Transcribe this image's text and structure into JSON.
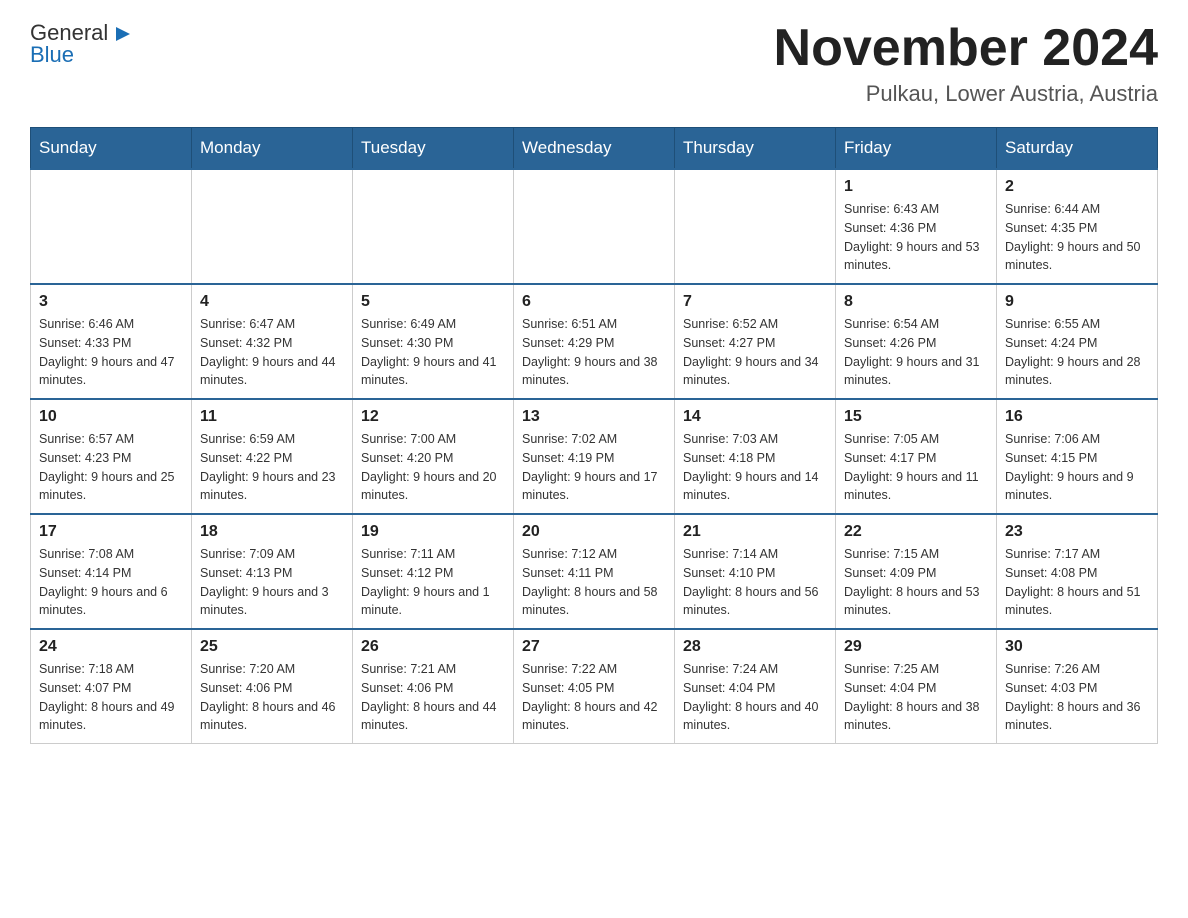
{
  "logo": {
    "text_general": "General",
    "text_blue": "Blue"
  },
  "header": {
    "title": "November 2024",
    "subtitle": "Pulkau, Lower Austria, Austria"
  },
  "days_of_week": [
    "Sunday",
    "Monday",
    "Tuesday",
    "Wednesday",
    "Thursday",
    "Friday",
    "Saturday"
  ],
  "weeks": [
    [
      {
        "day": "",
        "info": ""
      },
      {
        "day": "",
        "info": ""
      },
      {
        "day": "",
        "info": ""
      },
      {
        "day": "",
        "info": ""
      },
      {
        "day": "",
        "info": ""
      },
      {
        "day": "1",
        "info": "Sunrise: 6:43 AM\nSunset: 4:36 PM\nDaylight: 9 hours and 53 minutes."
      },
      {
        "day": "2",
        "info": "Sunrise: 6:44 AM\nSunset: 4:35 PM\nDaylight: 9 hours and 50 minutes."
      }
    ],
    [
      {
        "day": "3",
        "info": "Sunrise: 6:46 AM\nSunset: 4:33 PM\nDaylight: 9 hours and 47 minutes."
      },
      {
        "day": "4",
        "info": "Sunrise: 6:47 AM\nSunset: 4:32 PM\nDaylight: 9 hours and 44 minutes."
      },
      {
        "day": "5",
        "info": "Sunrise: 6:49 AM\nSunset: 4:30 PM\nDaylight: 9 hours and 41 minutes."
      },
      {
        "day": "6",
        "info": "Sunrise: 6:51 AM\nSunset: 4:29 PM\nDaylight: 9 hours and 38 minutes."
      },
      {
        "day": "7",
        "info": "Sunrise: 6:52 AM\nSunset: 4:27 PM\nDaylight: 9 hours and 34 minutes."
      },
      {
        "day": "8",
        "info": "Sunrise: 6:54 AM\nSunset: 4:26 PM\nDaylight: 9 hours and 31 minutes."
      },
      {
        "day": "9",
        "info": "Sunrise: 6:55 AM\nSunset: 4:24 PM\nDaylight: 9 hours and 28 minutes."
      }
    ],
    [
      {
        "day": "10",
        "info": "Sunrise: 6:57 AM\nSunset: 4:23 PM\nDaylight: 9 hours and 25 minutes."
      },
      {
        "day": "11",
        "info": "Sunrise: 6:59 AM\nSunset: 4:22 PM\nDaylight: 9 hours and 23 minutes."
      },
      {
        "day": "12",
        "info": "Sunrise: 7:00 AM\nSunset: 4:20 PM\nDaylight: 9 hours and 20 minutes."
      },
      {
        "day": "13",
        "info": "Sunrise: 7:02 AM\nSunset: 4:19 PM\nDaylight: 9 hours and 17 minutes."
      },
      {
        "day": "14",
        "info": "Sunrise: 7:03 AM\nSunset: 4:18 PM\nDaylight: 9 hours and 14 minutes."
      },
      {
        "day": "15",
        "info": "Sunrise: 7:05 AM\nSunset: 4:17 PM\nDaylight: 9 hours and 11 minutes."
      },
      {
        "day": "16",
        "info": "Sunrise: 7:06 AM\nSunset: 4:15 PM\nDaylight: 9 hours and 9 minutes."
      }
    ],
    [
      {
        "day": "17",
        "info": "Sunrise: 7:08 AM\nSunset: 4:14 PM\nDaylight: 9 hours and 6 minutes."
      },
      {
        "day": "18",
        "info": "Sunrise: 7:09 AM\nSunset: 4:13 PM\nDaylight: 9 hours and 3 minutes."
      },
      {
        "day": "19",
        "info": "Sunrise: 7:11 AM\nSunset: 4:12 PM\nDaylight: 9 hours and 1 minute."
      },
      {
        "day": "20",
        "info": "Sunrise: 7:12 AM\nSunset: 4:11 PM\nDaylight: 8 hours and 58 minutes."
      },
      {
        "day": "21",
        "info": "Sunrise: 7:14 AM\nSunset: 4:10 PM\nDaylight: 8 hours and 56 minutes."
      },
      {
        "day": "22",
        "info": "Sunrise: 7:15 AM\nSunset: 4:09 PM\nDaylight: 8 hours and 53 minutes."
      },
      {
        "day": "23",
        "info": "Sunrise: 7:17 AM\nSunset: 4:08 PM\nDaylight: 8 hours and 51 minutes."
      }
    ],
    [
      {
        "day": "24",
        "info": "Sunrise: 7:18 AM\nSunset: 4:07 PM\nDaylight: 8 hours and 49 minutes."
      },
      {
        "day": "25",
        "info": "Sunrise: 7:20 AM\nSunset: 4:06 PM\nDaylight: 8 hours and 46 minutes."
      },
      {
        "day": "26",
        "info": "Sunrise: 7:21 AM\nSunset: 4:06 PM\nDaylight: 8 hours and 44 minutes."
      },
      {
        "day": "27",
        "info": "Sunrise: 7:22 AM\nSunset: 4:05 PM\nDaylight: 8 hours and 42 minutes."
      },
      {
        "day": "28",
        "info": "Sunrise: 7:24 AM\nSunset: 4:04 PM\nDaylight: 8 hours and 40 minutes."
      },
      {
        "day": "29",
        "info": "Sunrise: 7:25 AM\nSunset: 4:04 PM\nDaylight: 8 hours and 38 minutes."
      },
      {
        "day": "30",
        "info": "Sunrise: 7:26 AM\nSunset: 4:03 PM\nDaylight: 8 hours and 36 minutes."
      }
    ]
  ]
}
